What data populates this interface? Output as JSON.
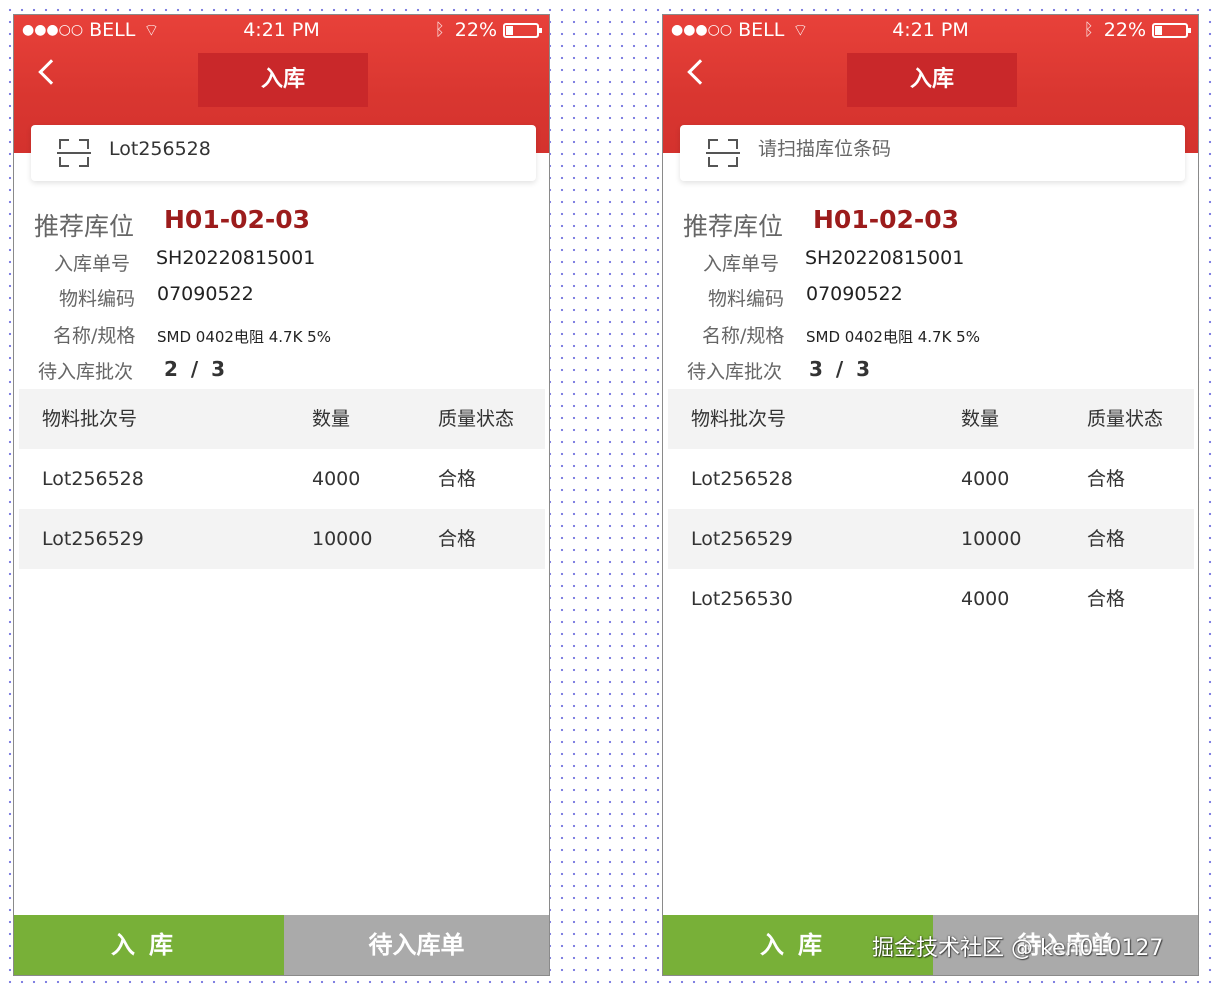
{
  "status_bar": {
    "signal": "●●●○○",
    "carrier": "BELL",
    "time": "4:21 PM",
    "battery": "22%"
  },
  "screens": [
    {
      "nav_title": "入库",
      "scan_value": "Lot256528",
      "recommend_label": "推荐库位",
      "recommend_value": "H01-02-03",
      "order_label": "入库单号",
      "order_value": "SH20220815001",
      "material_label": "物料编码",
      "material_value": "07090522",
      "spec_label": "名称/规格",
      "spec_value": "SMD 0402电阻 4.7K 5%",
      "batch_label": "待入库批次",
      "batch_value": "2 / 3",
      "table_headers": [
        "物料批次号",
        "数量",
        "质量状态"
      ],
      "rows": [
        {
          "lot": "Lot256528",
          "qty": "4000",
          "status": "合格"
        },
        {
          "lot": "Lot256529",
          "qty": "10000",
          "status": "合格"
        }
      ],
      "btn_primary": "入库",
      "btn_secondary": "待入库单"
    },
    {
      "nav_title": "入库",
      "scan_placeholder": "请扫描库位条码",
      "recommend_label": "推荐库位",
      "recommend_value": "H01-02-03",
      "order_label": "入库单号",
      "order_value": "SH20220815001",
      "material_label": "物料编码",
      "material_value": "07090522",
      "spec_label": "名称/规格",
      "spec_value": "SMD 0402电阻 4.7K 5%",
      "batch_label": "待入库批次",
      "batch_value": "3 / 3",
      "table_headers": [
        "物料批次号",
        "数量",
        "质量状态"
      ],
      "rows": [
        {
          "lot": "Lot256528",
          "qty": "4000",
          "status": "合格"
        },
        {
          "lot": "Lot256529",
          "qty": "10000",
          "status": "合格"
        },
        {
          "lot": "Lot256530",
          "qty": "4000",
          "status": "合格"
        }
      ],
      "btn_primary": "入库",
      "btn_secondary": "待入库单"
    }
  ],
  "watermark": "掘金技术社区 @ ken010127",
  "colors": {
    "header_red": "#d93630",
    "title_block": "#c9282a",
    "recommend_value": "#9c1c1c",
    "btn_green": "#78b038",
    "btn_gray": "#aaaaaa"
  }
}
